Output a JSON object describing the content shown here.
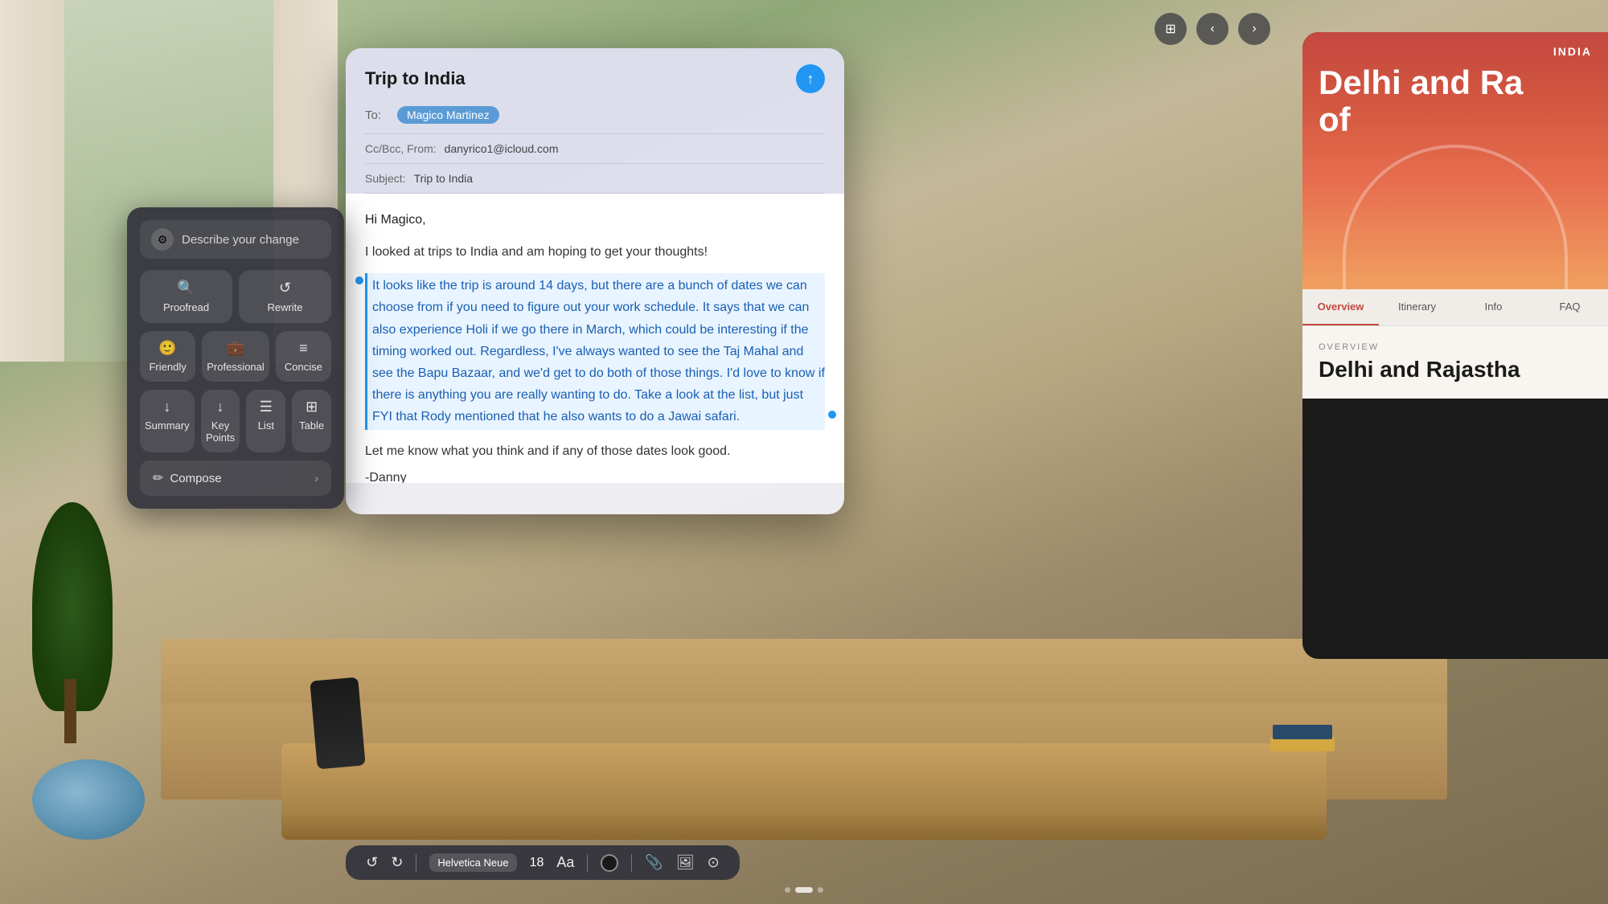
{
  "background": {
    "color": "#8a9a7a"
  },
  "window_controls": {
    "grid_icon": "⊞",
    "back_icon": "‹",
    "forward_icon": "›"
  },
  "email": {
    "title": "Trip to India",
    "to_label": "To:",
    "recipient": "Magico Martinez",
    "cc_label": "Cc/Bcc, From:",
    "cc_value": "danyrico1@icloud.com",
    "subject_label": "Subject:",
    "subject_value": "Trip to India",
    "greeting": "Hi Magico,",
    "intro": "I looked at trips to India and am hoping to get your thoughts!",
    "selected_body": "It looks like the trip is around 14 days, but there are a bunch of dates we can choose from if you need to figure out your work schedule. It says that we can also experience Holi if we go there in March, which could be interesting if the timing worked out. Regardless, I've always wanted to see the Taj Mahal and see the Bapu Bazaar, and we'd get to do both of those things.  I'd love to know if there is anything you are really wanting to do. Take a look at the list, but just FYI that Rody mentioned that he also wants to do a Jawai safari.",
    "closing": "Let me know what you think and if any of those dates look good.",
    "signature": "-Danny"
  },
  "toolbar": {
    "undo_label": "↺",
    "redo_label": "↻",
    "font_name": "Helvetica Neue",
    "font_size": "18",
    "format_icon": "Aa",
    "attachment_icon": "📎",
    "photo_icon": "🖼",
    "arrow_icon": "⊙"
  },
  "pagination": {
    "dots": [
      false,
      true,
      false
    ]
  },
  "writing_tools": {
    "describe_placeholder": "Describe your change",
    "describe_icon": "⚙",
    "proofread_label": "Proofread",
    "rewrite_label": "Rewrite",
    "friendly_label": "Friendly",
    "professional_label": "Professional",
    "concise_label": "Concise",
    "summary_label": "Summary",
    "key_points_label": "Key Points",
    "list_label": "List",
    "table_label": "Table",
    "compose_label": "Compose",
    "compose_icon": "✏"
  },
  "travel_panel": {
    "india_label": "INDIA",
    "title_line1": "Delhi and Ra",
    "title_line2": "of",
    "nav_items": [
      "Overview",
      "Itinerary",
      "Info",
      "FAQ"
    ],
    "active_nav": "Overview",
    "overview_label": "OVERVIEW",
    "overview_title": "Delhi and Rajastha"
  }
}
